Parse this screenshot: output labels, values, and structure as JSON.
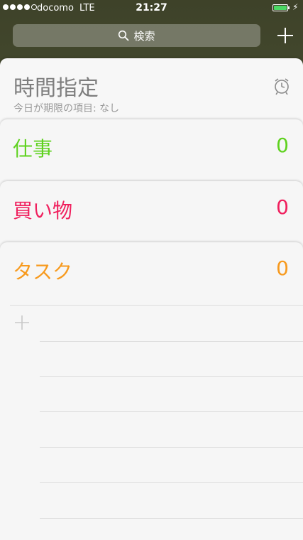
{
  "status": {
    "carrier": "docomo",
    "network": "LTE",
    "time": "21:27",
    "signal_bars": 4,
    "signal_max": 5,
    "battery_level": 1.0,
    "battery_color": "#4cd964"
  },
  "search": {
    "placeholder": "検索",
    "icon": "search-icon"
  },
  "header": {
    "add_icon": "plus-icon"
  },
  "scheduled": {
    "title": "時間指定",
    "subtitle": "今日が期限の項目: なし",
    "icon": "alarm-clock-icon"
  },
  "lists": [
    {
      "name": "仕事",
      "count": "0",
      "color": "#5fd21f"
    },
    {
      "name": "買い物",
      "count": "0",
      "color": "#f0205e"
    },
    {
      "name": "タスク",
      "count": "0",
      "color": "#f79a1e"
    }
  ],
  "new_item": {
    "icon": "plus-icon"
  }
}
